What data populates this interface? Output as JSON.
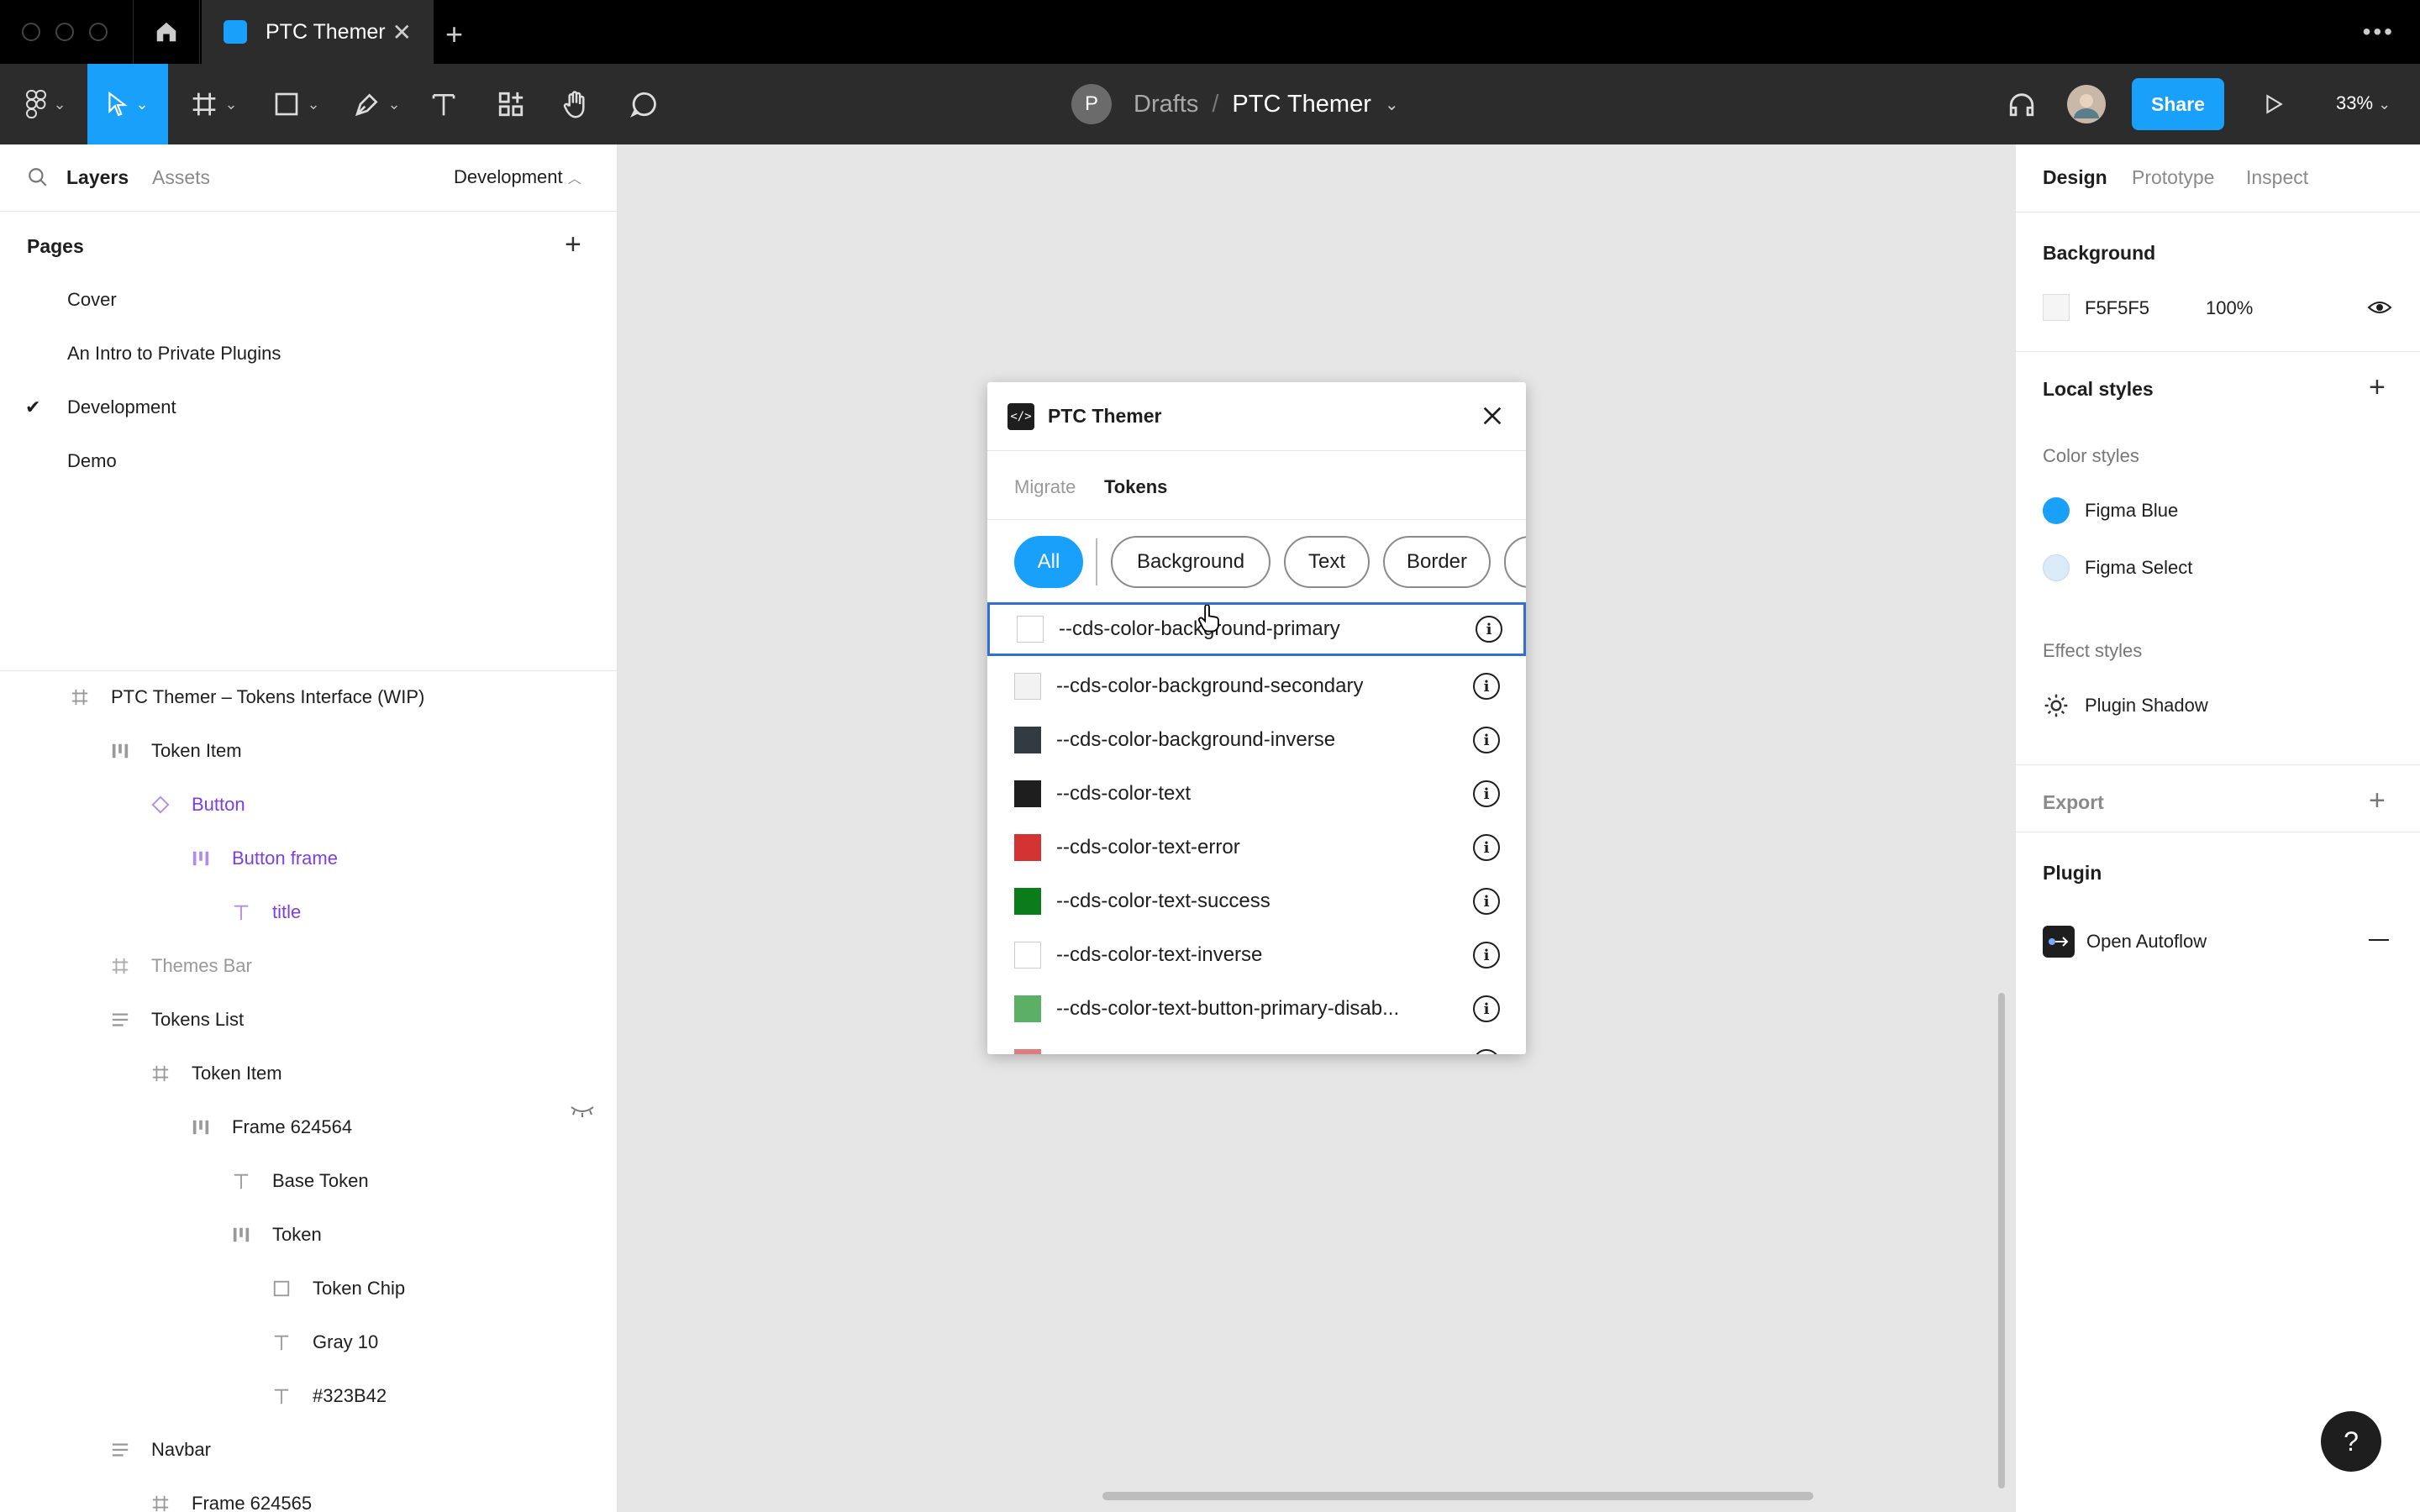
{
  "titlebar": {
    "tab_title": "PTC Themer",
    "new_tab": "+",
    "close_tab": "✕"
  },
  "toolbar": {
    "breadcrumb_drafts": "Drafts",
    "breadcrumb_sep": "/",
    "file_name": "PTC Themer",
    "avatar_letter": "P",
    "share_label": "Share",
    "zoom": "33%"
  },
  "left_panel": {
    "tab_layers": "Layers",
    "tab_assets": "Assets",
    "current_page": "Development",
    "pages_heading": "Pages",
    "pages": [
      "Cover",
      "An Intro to Private Plugins",
      "Development",
      "Demo"
    ],
    "layers": [
      {
        "name": "PTC Themer – Tokens Interface (WIP)",
        "icon": "frame-icon"
      },
      {
        "name": "Token Item",
        "icon": "auto-layout-icon"
      },
      {
        "name": "Button",
        "icon": "component-icon"
      },
      {
        "name": "Button frame",
        "icon": "auto-layout-icon"
      },
      {
        "name": "title",
        "icon": "text-icon"
      },
      {
        "name": "Themes Bar",
        "icon": "frame-icon"
      },
      {
        "name": "Tokens List",
        "icon": "vertical-stack-icon"
      },
      {
        "name": "Token Item",
        "icon": "frame-icon"
      },
      {
        "name": "Frame 624564",
        "icon": "auto-layout-icon"
      },
      {
        "name": "Base Token",
        "icon": "text-icon"
      },
      {
        "name": "Token",
        "icon": "auto-layout-icon"
      },
      {
        "name": "Token Chip",
        "icon": "rectangle-icon"
      },
      {
        "name": "Gray 10",
        "icon": "text-icon"
      },
      {
        "name": "#323B42",
        "icon": "text-icon"
      },
      {
        "name": "Navbar",
        "icon": "vertical-stack-icon"
      },
      {
        "name": "Frame 624565",
        "icon": "frame-icon"
      }
    ]
  },
  "plugin": {
    "title": "PTC Themer",
    "tab_migrate": "Migrate",
    "tab_tokens": "Tokens",
    "chips": [
      "All",
      "Background",
      "Text",
      "Border"
    ],
    "tokens": [
      {
        "name": "--cds-color-background-primary",
        "color": "#FFFFFF"
      },
      {
        "name": "--cds-color-background-secondary",
        "color": "#F2F2F2"
      },
      {
        "name": "--cds-color-background-inverse",
        "color": "#323B42"
      },
      {
        "name": "--cds-color-text",
        "color": "#1E1E1E"
      },
      {
        "name": "--cds-color-text-error",
        "color": "#D43333"
      },
      {
        "name": "--cds-color-text-success",
        "color": "#0A7D1A"
      },
      {
        "name": "--cds-color-text-inverse",
        "color": "#FFFFFF"
      },
      {
        "name": "--cds-color-text-button-primary-disab...",
        "color": "#5BB065"
      },
      {
        "name": "",
        "color": "#E07B7B"
      }
    ]
  },
  "right_panel": {
    "tab_design": "Design",
    "tab_prototype": "Prototype",
    "tab_inspect": "Inspect",
    "background_heading": "Background",
    "background_hex": "F5F5F5",
    "background_opacity": "100%",
    "local_styles_heading": "Local styles",
    "color_styles_label": "Color styles",
    "color_styles": [
      {
        "name": "Figma Blue",
        "color": "#18A0FB"
      },
      {
        "name": "Figma Select",
        "color": "#DAEBF7"
      }
    ],
    "effect_styles_label": "Effect styles",
    "effect_style": "Plugin Shadow",
    "export_heading": "Export",
    "plugin_heading": "Plugin",
    "plugin_name": "Open Autoflow"
  },
  "help": "?"
}
